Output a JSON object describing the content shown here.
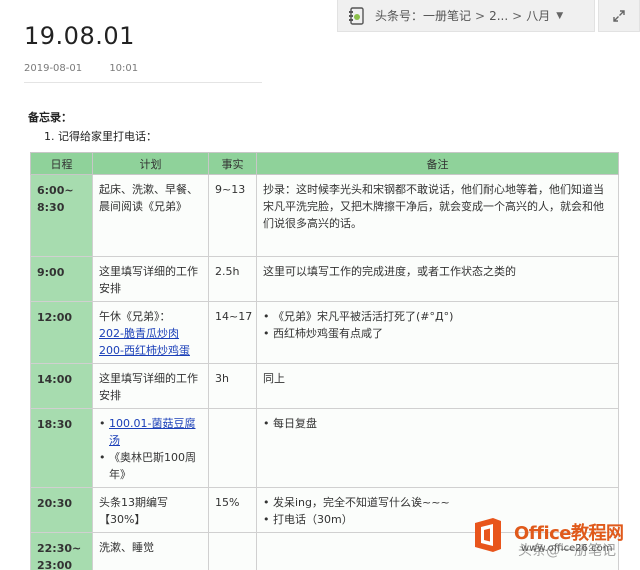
{
  "breadcrumb": {
    "notebook": "头条号：一册笔记",
    "mid": "2...",
    "current": "八月"
  },
  "note": {
    "title": "19.08.01",
    "date": "2019-08-01",
    "time": "10:01"
  },
  "memo": {
    "label": "备忘录：",
    "item_1": "1. 记得给家里打电话："
  },
  "table": {
    "headers": [
      "日程",
      "计划",
      "事实",
      "备注"
    ],
    "rows": [
      {
        "time": "6:00~\n8:30",
        "plan": "起床、洗漱、早餐、晨间阅读《兄弟》",
        "fact": "9~13",
        "note": "抄录：这时候李光头和宋钢都不敢说话，他们耐心地等着，他们知道当宋凡平洗完脸，又把木牌擦干净后，就会变成一个高兴的人，就会和他们说很多高兴的话。"
      },
      {
        "time": "9:00",
        "plan": "这里填写详细的工作安排",
        "fact": "2.5h",
        "note": "这里可以填写工作的完成进度，或者工作状态之类的"
      },
      {
        "time": "12:00",
        "plan_text": "午休《兄弟》：",
        "plan_link1": "202-脆青瓜炒肉",
        "plan_link2": "200-西红柿炒鸡蛋",
        "fact": "14~17",
        "note_bullets": [
          "《兄弟》宋凡平被活活打死了(#°Д°)",
          "西红柿炒鸡蛋有点咸了"
        ]
      },
      {
        "time": "14:00",
        "plan": "这里填写详细的工作安排",
        "fact": "3h",
        "note": "同上"
      },
      {
        "time": "18:30",
        "plan_link": "100.01-菌菇豆腐汤",
        "plan_bullet2": "《奥林巴斯100周年》",
        "fact": "",
        "note_bullets": [
          "每日复盘"
        ]
      },
      {
        "time": "20:30",
        "plan": "头条13期编写【30%】",
        "fact": "15%",
        "note_bullets": [
          "发呆ing，完全不知道写什么诶~~~",
          "打电话（30m）"
        ]
      },
      {
        "time": "22:30~\n23:00",
        "plan": "洗漱、睡觉",
        "fact": "",
        "note": ""
      }
    ]
  },
  "watermark": {
    "brand": "Office教程网",
    "url": "www.office26.com",
    "overlay": "头条@一册笔记"
  },
  "colors": {
    "header_green": "#8fd29a",
    "time_green": "#a7dcaf",
    "link_blue": "#1a3fb8",
    "brand_orange": "#e05a1b"
  }
}
